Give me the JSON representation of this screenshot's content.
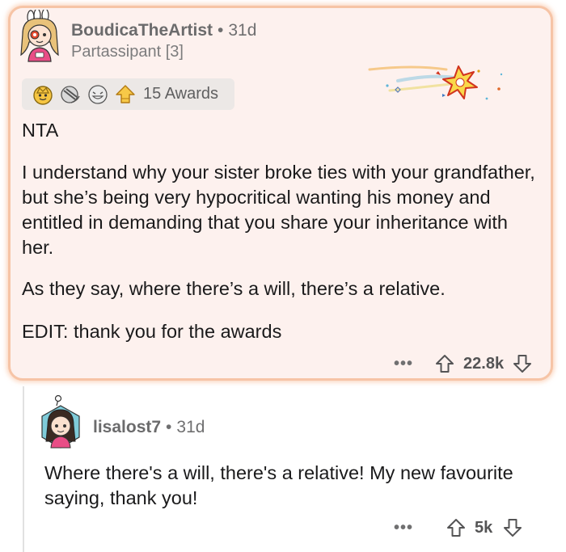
{
  "top_comment": {
    "author": "BoudicaTheArtist",
    "separator": "•",
    "age": "31d",
    "flair": "Partassipant [3]",
    "awards": {
      "icons": [
        "gold-hat-award-icon",
        "facepalm-award-icon",
        "grinning-award-icon",
        "rocket-like-award-icon"
      ],
      "label": "15 Awards"
    },
    "paragraphs": [
      "NTA",
      "I understand why your sister broke ties with your grandfather, but she’s being very hypocritical wanting his money and entitled in demanding that you share your inheritance with her.",
      "As they say, where there’s a will, there’s a relative.",
      "EDIT: thank you for the awards"
    ],
    "more_label": "•••",
    "score": "22.8k"
  },
  "reply": {
    "author": "lisalost7",
    "separator": "•",
    "age": "31d",
    "text": "Where there's a will, there's a relative! My new favourite saying, thank you!",
    "more_label": "•••",
    "score": "5k"
  },
  "colors": {
    "highlight_bg": "#fdf1ee",
    "highlight_border": "#f6c4a6",
    "muted_text": "#6f6f70",
    "body_text": "#1a1a1b"
  }
}
